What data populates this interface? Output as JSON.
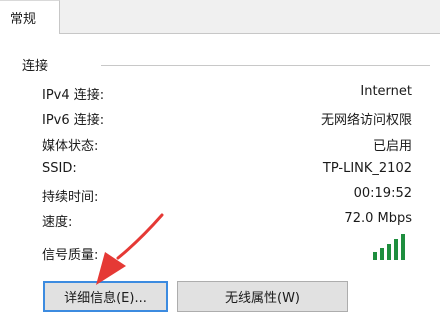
{
  "tab": {
    "label": "常规"
  },
  "group": {
    "title": "连接"
  },
  "rows": [
    {
      "label": "IPv4 连接:",
      "value": "Internet"
    },
    {
      "label": "IPv6 连接:",
      "value": "无网络访问权限"
    },
    {
      "label": "媒体状态:",
      "value": "已启用"
    },
    {
      "label": "SSID:",
      "value": "TP-LINK_2102"
    },
    {
      "label": "持续时间:",
      "value": "00:19:52"
    },
    {
      "label": "速度:",
      "value": "72.0 Mbps"
    }
  ],
  "signal": {
    "label": "信号质量:",
    "level": 1.0,
    "color": "#1e8e3e",
    "icon": "signal-bars-icon"
  },
  "buttons": {
    "details": "详细信息(E)...",
    "wireless": "无线属性(W)"
  },
  "annotation": {
    "color": "#e53935"
  }
}
